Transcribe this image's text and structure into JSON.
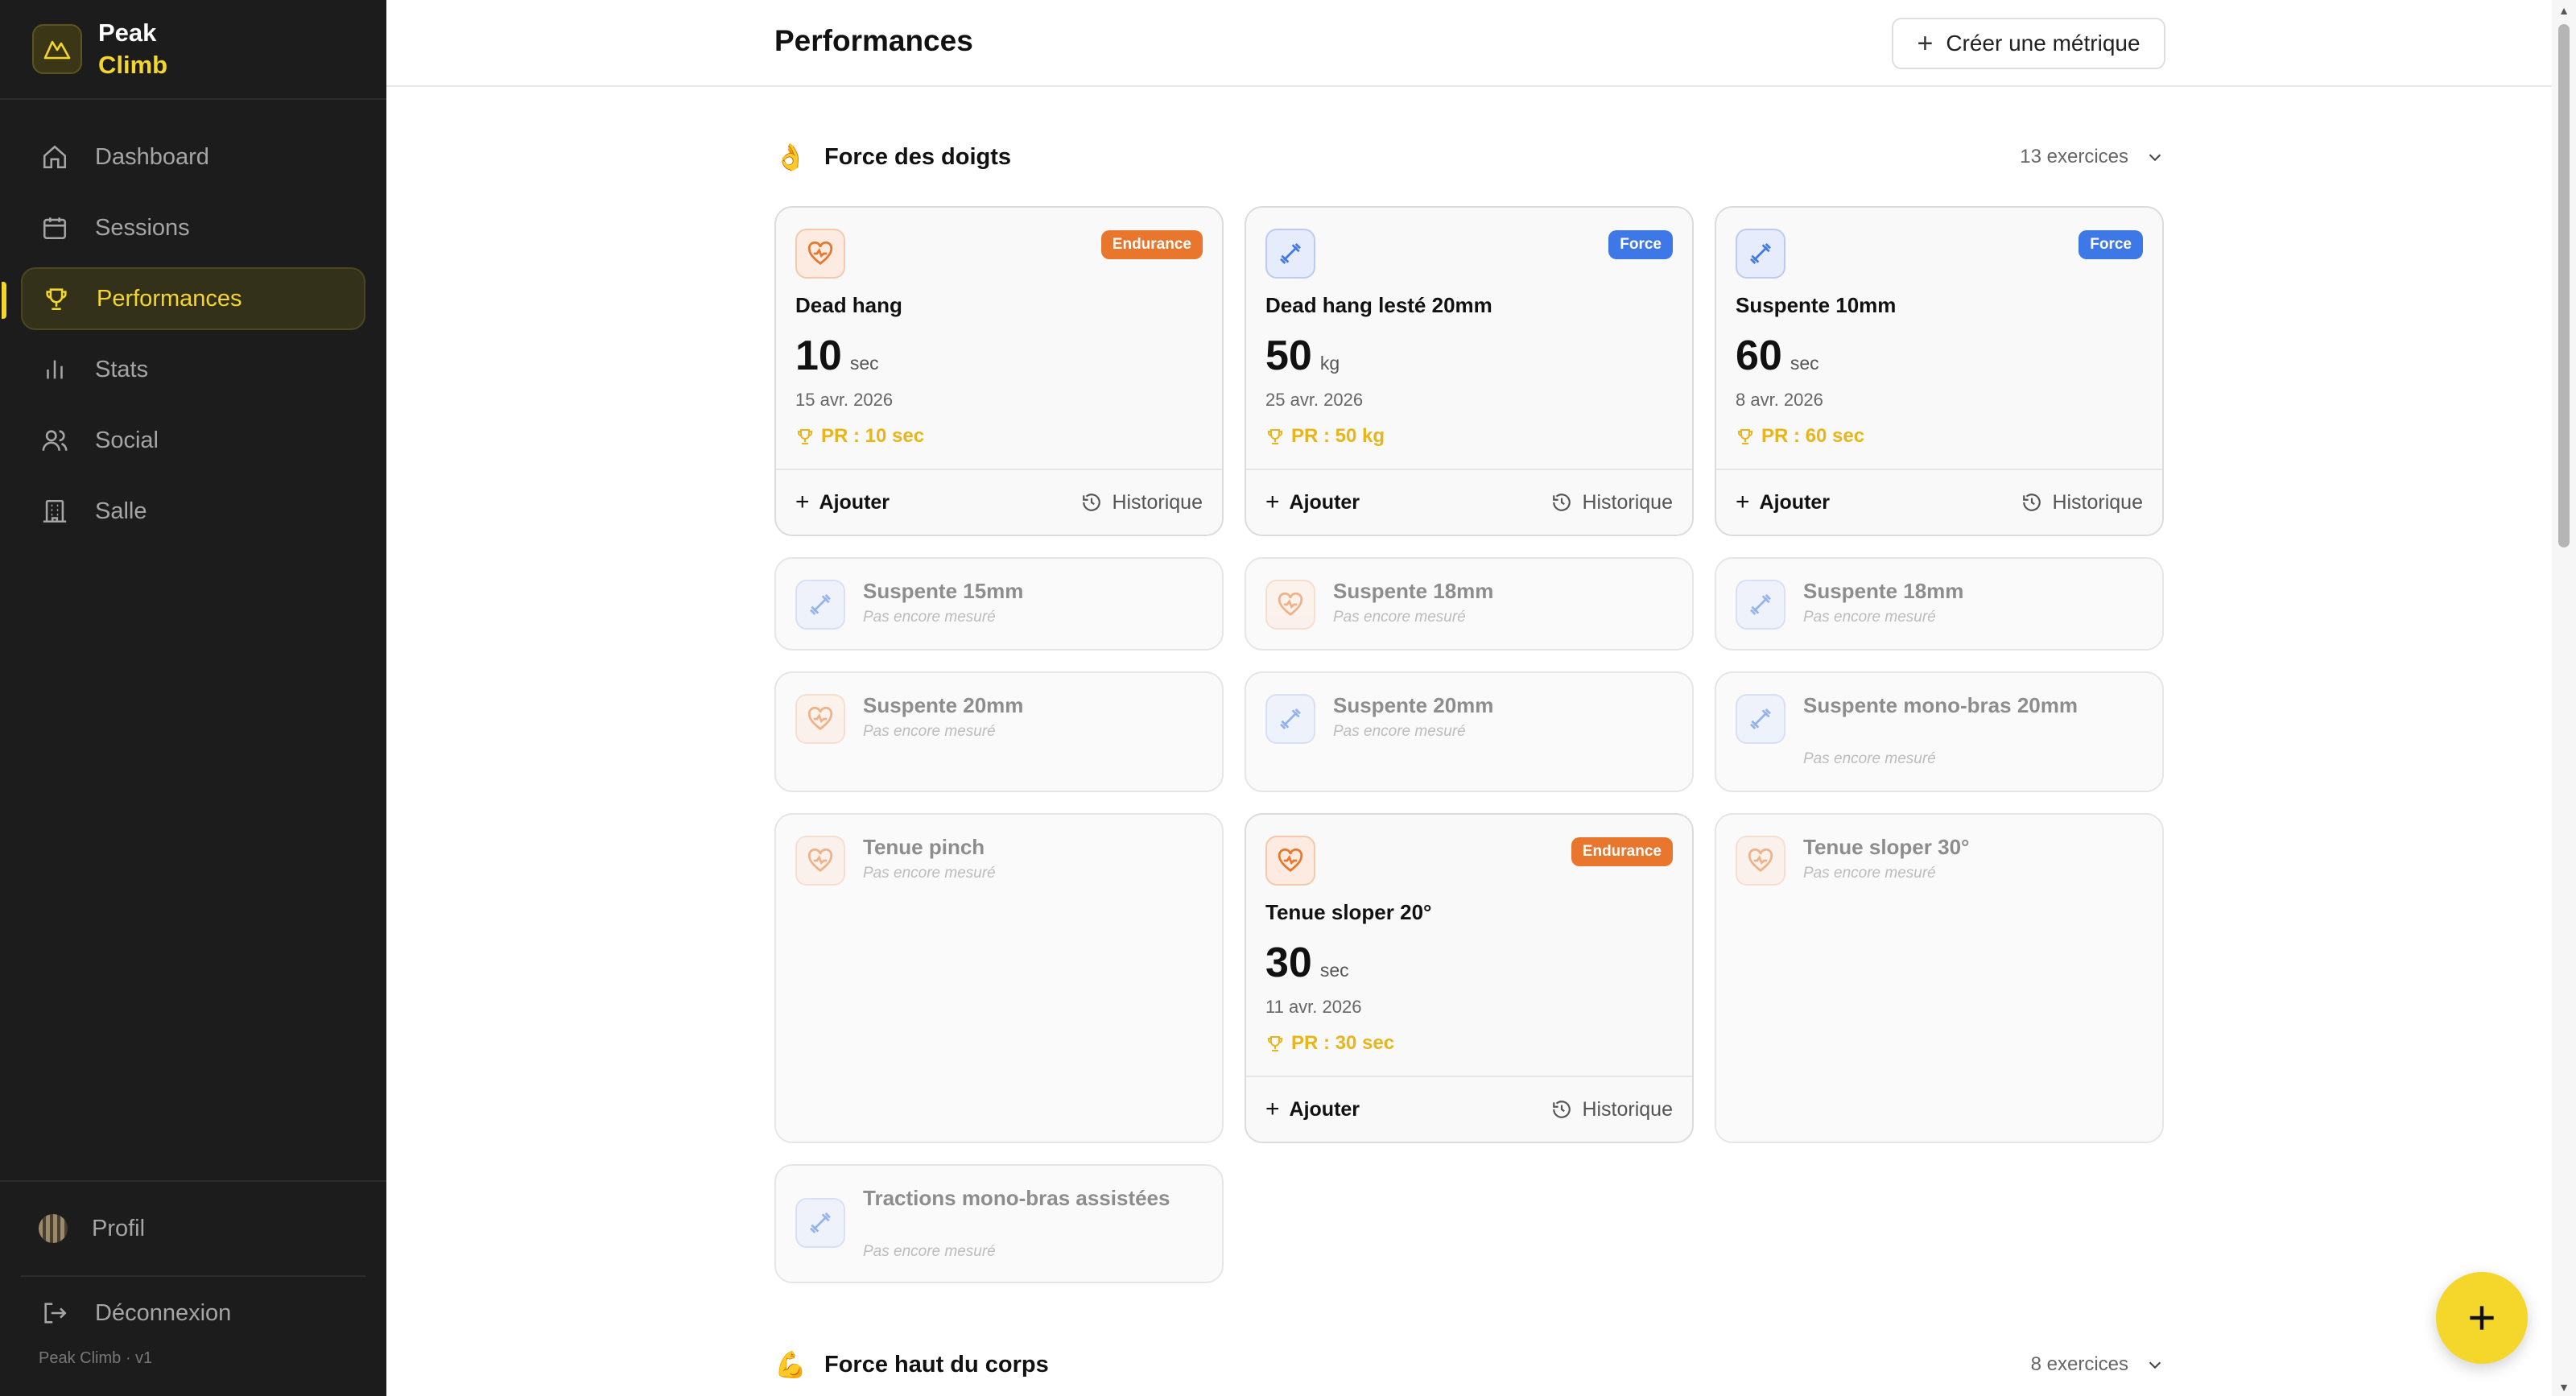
{
  "app": {
    "name_line1": "Peak",
    "name_line2": "Climb",
    "version": "Peak Climb · v1"
  },
  "sidebar": {
    "items": [
      {
        "label": "Dashboard",
        "icon": "home-icon",
        "active": false
      },
      {
        "label": "Sessions",
        "icon": "calendar-icon",
        "active": false
      },
      {
        "label": "Performances",
        "icon": "trophy-icon",
        "active": true
      },
      {
        "label": "Stats",
        "icon": "bar-chart-icon",
        "active": false
      },
      {
        "label": "Social",
        "icon": "users-icon",
        "active": false
      },
      {
        "label": "Salle",
        "icon": "building-icon",
        "active": false
      }
    ],
    "profile_label": "Profil",
    "logout_label": "Déconnexion"
  },
  "header": {
    "title": "Performances",
    "create_label": "Créer une métrique"
  },
  "sections": [
    {
      "emoji": "👌",
      "title": "Force des doigts",
      "count": "13 exercices",
      "cards": [
        {
          "name": "Dead hang",
          "badge": "Endurance",
          "type": "endurance",
          "value": "10",
          "unit": "sec",
          "date": "15 avr. 2026",
          "pr": "PR : 10 sec",
          "add": "Ajouter",
          "history": "Historique"
        },
        {
          "name": "Dead hang lesté 20mm",
          "badge": "Force",
          "type": "force",
          "value": "50",
          "unit": "kg",
          "date": "25 avr. 2026",
          "pr": "PR : 50 kg",
          "add": "Ajouter",
          "history": "Historique"
        },
        {
          "name": "Suspente 10mm",
          "badge": "Force",
          "type": "force",
          "value": "60",
          "unit": "sec",
          "date": "8 avr. 2026",
          "pr": "PR : 60 sec",
          "add": "Ajouter",
          "history": "Historique"
        },
        {
          "name": "Suspente 15mm",
          "type": "force",
          "sub": "Pas encore mesuré"
        },
        {
          "name": "Suspente 18mm",
          "type": "endurance",
          "sub": "Pas encore mesuré"
        },
        {
          "name": "Suspente 18mm",
          "type": "force",
          "sub": "Pas encore mesuré"
        },
        {
          "name": "Suspente 20mm",
          "type": "endurance",
          "sub": "Pas encore mesuré"
        },
        {
          "name": "Suspente 20mm",
          "type": "force",
          "sub": "Pas encore mesuré"
        },
        {
          "name": "Suspente mono-bras 20mm",
          "type": "force",
          "sub": "Pas encore mesuré"
        },
        {
          "name": "Tenue pinch",
          "type": "endurance",
          "sub": "Pas encore mesuré"
        },
        {
          "name": "Tenue sloper 20°",
          "badge": "Endurance",
          "type": "endurance",
          "value": "30",
          "unit": "sec",
          "date": "11 avr. 2026",
          "pr": "PR : 30 sec",
          "add": "Ajouter",
          "history": "Historique"
        },
        {
          "name": "Tenue sloper 30°",
          "type": "endurance",
          "sub": "Pas encore mesuré"
        },
        {
          "name": "Tractions mono-bras assistées",
          "type": "force",
          "sub": "Pas encore mesuré"
        }
      ]
    },
    {
      "emoji": "💪",
      "title": "Force haut du corps",
      "count": "8 exercices"
    }
  ],
  "colors": {
    "accent": "#f5d62a",
    "endurance": "#e8762c",
    "force": "#3d78e6",
    "pr": "#e8b51a",
    "sidebar_bg": "#1c1c1c"
  }
}
